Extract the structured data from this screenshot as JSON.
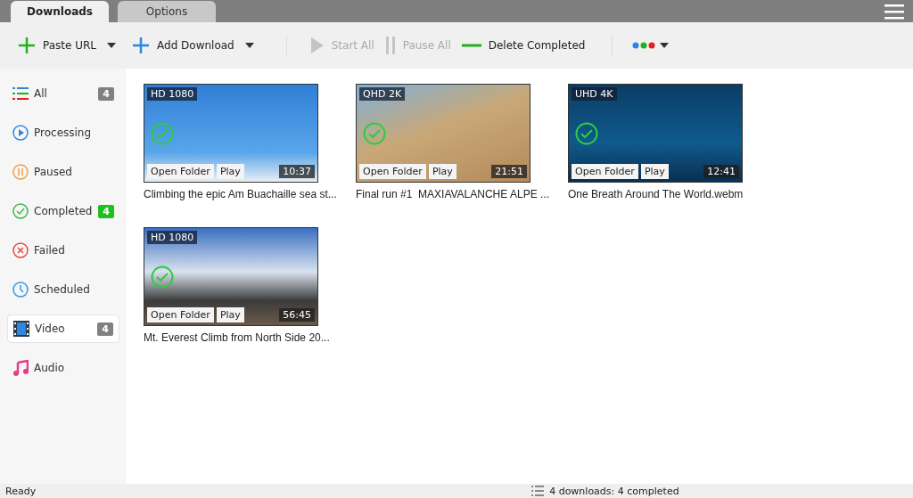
{
  "tabs": [
    {
      "label": "Downloads",
      "selected": true
    },
    {
      "label": "Options",
      "selected": false
    }
  ],
  "toolbar": [
    {
      "kind": "paste",
      "label": "Paste URL",
      "disabled": false,
      "dropdown": true
    },
    {
      "kind": "add",
      "label": "Add Download",
      "disabled": false,
      "dropdown": true
    },
    {
      "kind": "start",
      "label": "Start All",
      "disabled": true,
      "dropdown": false
    },
    {
      "kind": "pause",
      "label": "Pause All",
      "disabled": true,
      "dropdown": false
    },
    {
      "kind": "delete",
      "label": "Delete Completed",
      "disabled": false,
      "dropdown": false
    }
  ],
  "sidebar": {
    "items": [
      {
        "kind": "all",
        "label": "All",
        "count": "4",
        "color": "#808080",
        "selected": false
      },
      {
        "kind": "processing",
        "label": "Processing",
        "selected": false
      },
      {
        "kind": "paused",
        "label": "Paused",
        "selected": false
      },
      {
        "kind": "completed",
        "label": "Completed",
        "count": "4",
        "color": "#1ec01e",
        "selected": false
      },
      {
        "kind": "failed",
        "label": "Failed",
        "selected": false
      },
      {
        "kind": "scheduled",
        "label": "Scheduled",
        "selected": false
      },
      {
        "kind": "video",
        "label": "Video",
        "count": "4",
        "color": "#808080",
        "selected": true
      },
      {
        "kind": "audio",
        "label": "Audio",
        "selected": false
      }
    ]
  },
  "downloads": [
    {
      "quality": "HD 1080",
      "duration": "10:37",
      "title": "Climbing the epic Am Buachaille sea st...",
      "completed": true,
      "open_folder": "Open Folder",
      "play": "Play"
    },
    {
      "quality": "QHD 2K",
      "duration": "21:51",
      "title": "Final run #1  MAXIAVALANCHE ALPE ...",
      "completed": true,
      "open_folder": "Open Folder",
      "play": "Play"
    },
    {
      "quality": "UHD 4K",
      "duration": "12:41",
      "title": "One Breath Around The World.webm",
      "completed": true,
      "open_folder": "Open Folder",
      "play": "Play"
    },
    {
      "quality": "HD 1080",
      "duration": "56:45",
      "title": "Mt. Everest Climb from North Side 20...",
      "completed": true,
      "open_folder": "Open Folder",
      "play": "Play"
    }
  ],
  "status_bar": {
    "left": "Ready",
    "summary": "4 downloads: 4 completed"
  }
}
